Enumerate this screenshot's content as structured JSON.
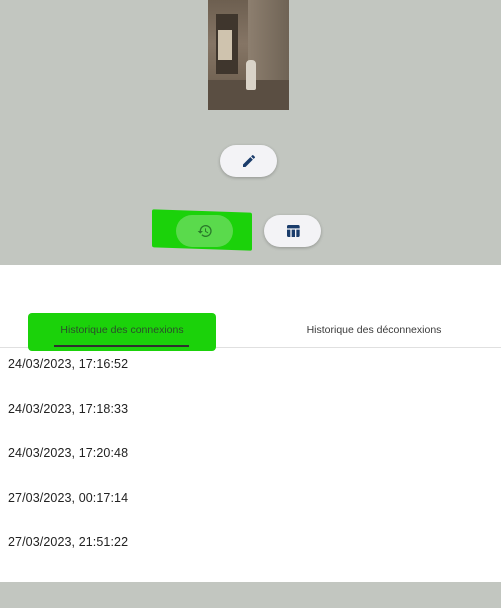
{
  "tabs": [
    {
      "label": "Historique des connexions"
    },
    {
      "label": "Historique des déconnexions"
    }
  ],
  "timestamps": [
    "24/03/2023, 17:16:52",
    "24/03/2023, 17:18:33",
    "24/03/2023, 17:20:48",
    "27/03/2023, 00:17:14",
    "27/03/2023, 21:51:22"
  ],
  "icons": {
    "edit": "pencil-icon",
    "history": "history-icon",
    "table": "table-icon"
  },
  "colors": {
    "background": "#c2c6c0",
    "highlight": "#1bd20a",
    "icon_primary": "#1a3c6b"
  }
}
